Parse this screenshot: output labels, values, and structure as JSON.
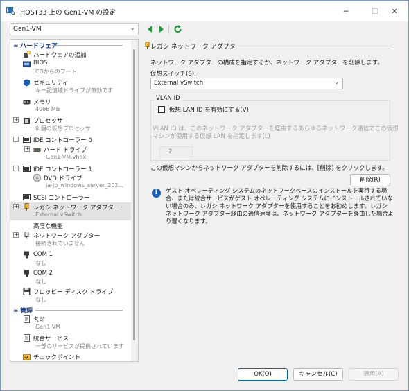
{
  "window": {
    "title": "HOST33 上の Gen1-VM の設定",
    "minimize_glyph": "─",
    "maximize_glyph": "☐",
    "close_glyph": "✕"
  },
  "toolbar": {
    "vm_selected": "Gen1-VM",
    "icons": [
      "back-arrow-icon",
      "forward-arrow-icon",
      "refresh-icon"
    ]
  },
  "sidebar": {
    "hardware_header": "ハードウェア",
    "management_header": "管理",
    "items": [
      {
        "label": "ハードウェアの追加",
        "sub": ""
      },
      {
        "label": "BIOS",
        "sub": "CDからのブート"
      },
      {
        "label": "セキュリティ",
        "sub": "キー記憶域ドライブが無効です"
      },
      {
        "label": "メモリ",
        "sub": "4096 MB"
      },
      {
        "label": "プロセッサ",
        "sub": "8 個の仮想プロセッサ"
      },
      {
        "label": "IDE コントローラー 0",
        "sub": ""
      },
      {
        "label": "ハード ドライブ",
        "sub": "Gen1-VM.vhdx"
      },
      {
        "label": "IDE コントローラー 1",
        "sub": ""
      },
      {
        "label": "DVD ドライブ",
        "sub": "ja-jp_windows_server_202..."
      },
      {
        "label": "SCSI コントローラー",
        "sub": ""
      },
      {
        "label": "レガシ ネットワーク アダプター",
        "sub": "External vSwitch"
      },
      {
        "label": "高度な機能",
        "sub": ""
      },
      {
        "label": "ネットワーク アダプター",
        "sub": "接続されていません"
      },
      {
        "label": "COM 1",
        "sub": "なし"
      },
      {
        "label": "COM 2",
        "sub": "なし"
      },
      {
        "label": "フロッピー ディスク ドライブ",
        "sub": "なし"
      },
      {
        "label": "名前",
        "sub": "Gen1-VM"
      },
      {
        "label": "統合サービス",
        "sub": "一部のサービスが提供されています"
      },
      {
        "label": "チェックポイント",
        "sub": ""
      }
    ]
  },
  "detail": {
    "group_title": "レガシ ネットワーク アダプター",
    "description": "ネットワーク アダプターの構成を指定するか、ネットワーク アダプターを削除します。",
    "switch_label": "仮想スイッチ(S):",
    "switch_value": "External vSwitch",
    "vlan_header": "VLAN ID",
    "vlan_checkbox_label": "仮想 LAN ID を有効にする(V)",
    "vlan_desc_line1": "VLAN ID は、このネットワーク アダプターを経由するあらゆるネットワーク通信でこの仮想",
    "vlan_desc_line2": "マシンが使用する仮想 LAN を指定します(L)",
    "vlan_value": "2",
    "remove_desc": "この仮想マシンからネットワーク アダプターを削除するには、[削除] をクリックします。",
    "remove_button": "削除(R)",
    "info_glyph": "i",
    "info_text": "ゲスト オペレーティング システムのネットワークベースのインストールを実行する場合、または統合サービスがゲスト オペレーティング システムにインストールされていない場合のみ、レガシ ネットワーク アダプターを使用することをお勧めします。レガシ ネットワーク アダプター経由の通信速度は、ネットワーク アダプターを経由した場合より遅くなります。"
  },
  "buttons": {
    "ok": "OK(O)",
    "cancel": "キャンセル(C)",
    "apply": "適用(A)"
  },
  "colors": {
    "accent": "#0067c0",
    "section_header": "#1a3d8f",
    "selected_row": "#e3e3e3",
    "nav_green": "#1e9a3a"
  }
}
